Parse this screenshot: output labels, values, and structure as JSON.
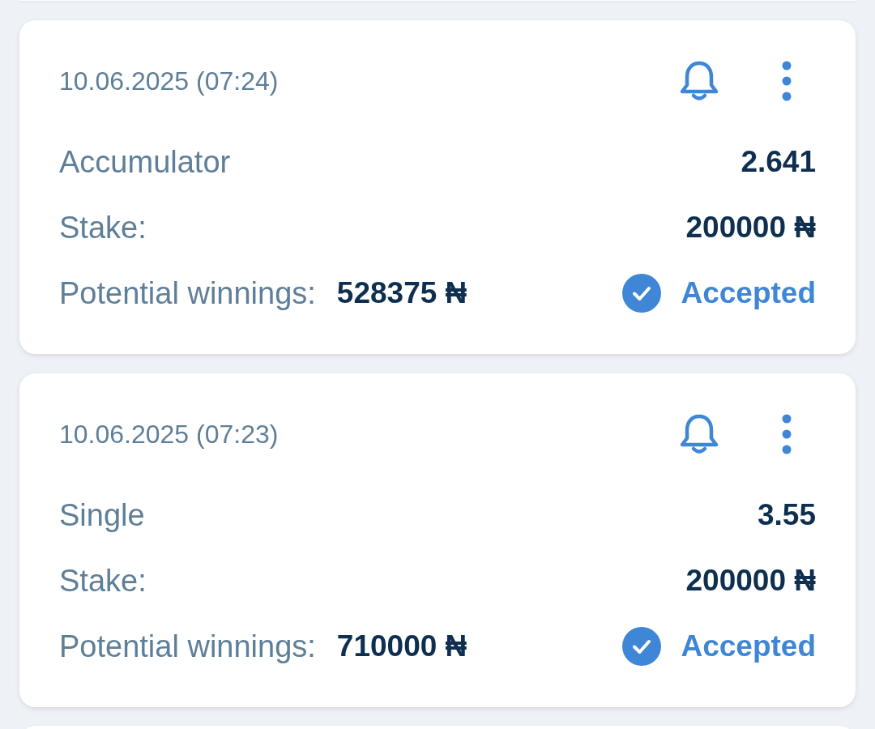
{
  "bets": [
    {
      "date": "10.06.2025 (07:24)",
      "type": "Accumulator",
      "odds": "2.641",
      "stake_label": "Stake:",
      "stake": "200000 ₦",
      "winnings_label": "Potential winnings:",
      "winnings": "528375 ₦",
      "status": {
        "kind": "accepted",
        "label": "Accepted"
      }
    },
    {
      "date": "10.06.2025 (07:23)",
      "type": "Single",
      "odds": "3.55",
      "stake_label": "Stake:",
      "stake": "200000 ₦",
      "winnings_label": "Potential winnings:",
      "winnings": "710000 ₦",
      "status": {
        "kind": "accepted",
        "label": "Accepted"
      }
    }
  ]
}
